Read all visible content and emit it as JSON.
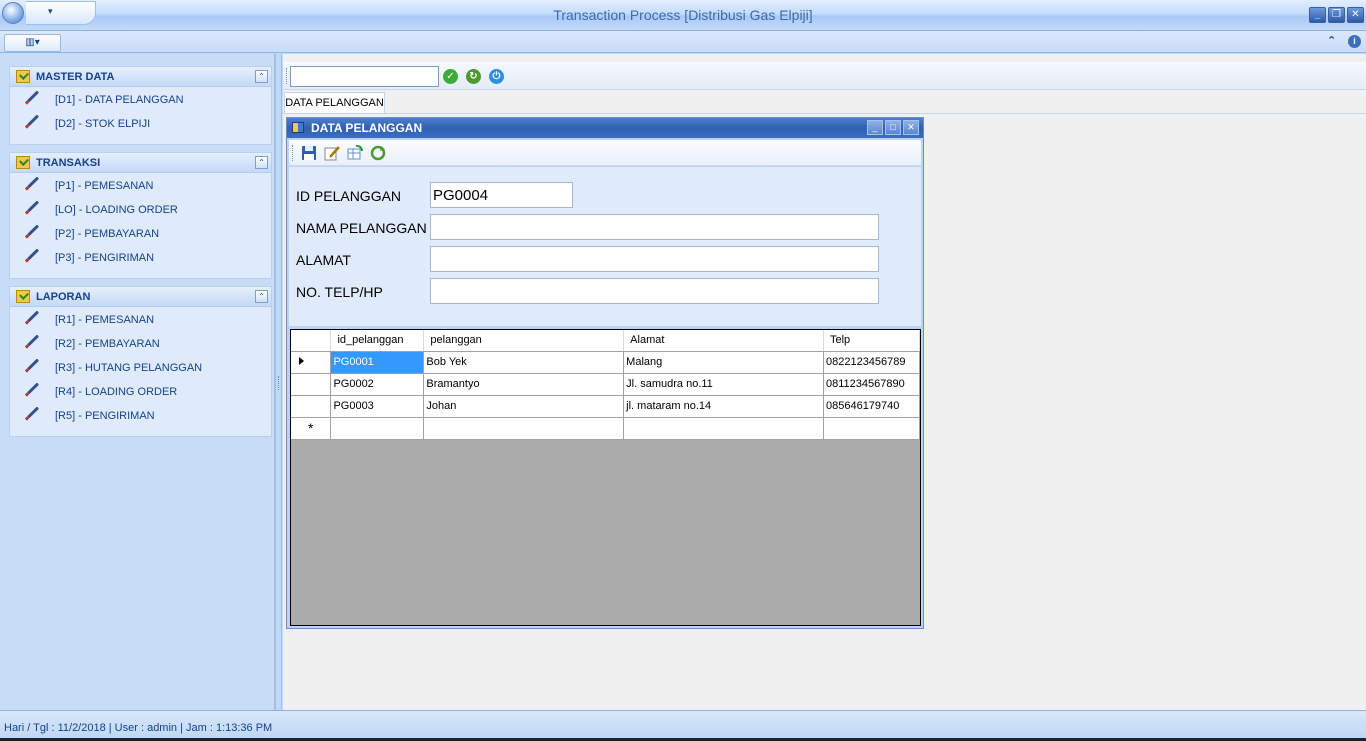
{
  "window": {
    "title": "Transaction Process [Distribusi Gas Elpiji]",
    "qat_dropdown": "▾",
    "minimize": "_",
    "restore": "❐",
    "close": "✕"
  },
  "ribbon": {
    "view_button": "▥▾",
    "collapse": "⌃",
    "info": "i"
  },
  "sidebar": {
    "groups": [
      {
        "title": "MASTER DATA",
        "collapse": "⌃",
        "items": [
          {
            "label": "[D1] - DATA PELANGGAN"
          },
          {
            "label": "[D2] - STOK ELPIJI"
          }
        ]
      },
      {
        "title": "TRANSAKSI",
        "collapse": "⌃",
        "items": [
          {
            "label": "[P1] - PEMESANAN"
          },
          {
            "label": "[LO] - LOADING ORDER"
          },
          {
            "label": "[P2] - PEMBAYARAN"
          },
          {
            "label": "[P3] - PENGIRIMAN"
          }
        ]
      },
      {
        "title": "LAPORAN",
        "collapse": "⌃",
        "items": [
          {
            "label": "[R1] - PEMESANAN"
          },
          {
            "label": "[R2] - PEMBAYARAN"
          },
          {
            "label": "[R3] - HUTANG PELANGGAN"
          },
          {
            "label": "[R4]  - LOADING ORDER"
          },
          {
            "label": "[R5]  - PENGIRIMAN"
          }
        ]
      }
    ]
  },
  "toolbar": {
    "search_value": "",
    "ok_icon": "✓",
    "refresh_icon": "↻",
    "power_icon": "⏻"
  },
  "tab": {
    "label": "DATA PELANGGAN"
  },
  "child": {
    "title": "DATA PELANGGAN",
    "min": "_",
    "max": "□",
    "close": "✕",
    "form": {
      "id_label": "ID PELANGGAN",
      "id_value": "PG0004",
      "nama_label": "NAMA PELANGGAN",
      "nama_value": "",
      "alamat_label": "ALAMAT",
      "alamat_value": "",
      "telp_label": "NO. TELP/HP",
      "telp_value": ""
    },
    "grid": {
      "columns": [
        "id_pelanggan",
        "pelanggan",
        "Alamat",
        "Telp"
      ],
      "rows": [
        [
          "PG0001",
          "Bob Yek",
          "Malang",
          "0822123456789"
        ],
        [
          "PG0002",
          "Bramantyo",
          "Jl. samudra no.11",
          "0811234567890"
        ],
        [
          "PG0003",
          "Johan",
          "jl. mataram no.14",
          "085646179740"
        ]
      ],
      "new_row_marker": "*"
    }
  },
  "status": {
    "text": "Hari / Tgl :  11/2/2018  |  User :  admin  |  Jam :  1:13:36 PM"
  },
  "colors": {
    "accent": "#15428b",
    "selection": "#3399ff"
  }
}
